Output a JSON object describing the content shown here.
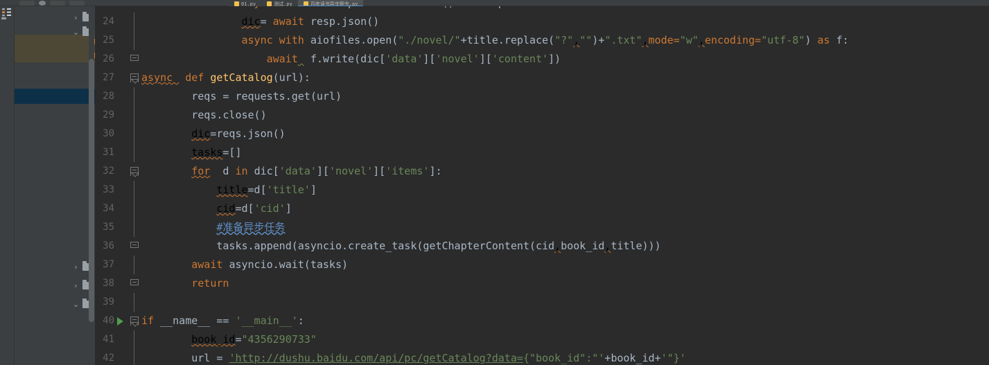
{
  "app": {
    "theme": "darcula",
    "accent_hex": "#4a88c7",
    "editor_bg_hex": "#2b2b2b",
    "panel_bg_hex": "#3c3f41",
    "selection_blue_hex": "#0d3049",
    "highlight_olive_hex": "#4d4836"
  },
  "toolbar": {
    "buttons": [
      {
        "name": "open-button",
        "label": ""
      },
      {
        "name": "save-button",
        "label": ""
      },
      {
        "name": "sync-button",
        "label": ""
      },
      {
        "name": "undo-button",
        "label": ""
      },
      {
        "name": "redo-button",
        "label": ""
      }
    ]
  },
  "tabs": [
    {
      "name": "tab-file-1",
      "label": "01.py",
      "active": false,
      "icon": "python-file-icon"
    },
    {
      "name": "tab-file-2",
      "label": "测试.py",
      "active": false,
      "icon": "python-file-icon"
    },
    {
      "name": "tab-file-3",
      "label": "百度读书异步爬虫.py",
      "active": true,
      "icon": "python-file-icon"
    }
  ],
  "left_strip": {
    "items": [
      {
        "name": "structure-tool-icon",
        "label": "Structure"
      },
      {
        "name": "project-folder-icon",
        "label": "Project"
      }
    ]
  },
  "project_tree": {
    "scrollbar": {
      "name": "project-scrollbar",
      "visible": true
    },
    "rows": [
      {
        "name": "tree-row-collapsed-1",
        "chevron": "chevron-right-icon",
        "icon": "folder-icon",
        "label": "",
        "state": "collapsed"
      },
      {
        "name": "tree-row-expanded-1",
        "chevron": "chevron-down-icon",
        "icon": "folder-icon",
        "label": "",
        "state": "expanded"
      },
      {
        "name": "tree-row-highlight-1",
        "chevron": "",
        "icon": "",
        "label": "",
        "state": "highlighted"
      },
      {
        "name": "tree-row-highlight-2",
        "chevron": "",
        "icon": "",
        "label": "",
        "state": "highlighted"
      },
      {
        "name": "tree-row-plain-1",
        "chevron": "",
        "icon": "",
        "label": "",
        "state": "normal"
      },
      {
        "name": "tree-row-selected",
        "chevron": "",
        "icon": "",
        "label": "",
        "state": "selected"
      },
      {
        "name": "tree-row-collapsed-2",
        "chevron": "chevron-right-icon",
        "icon": "folder-icon",
        "label": "",
        "state": "collapsed"
      },
      {
        "name": "tree-row-collapsed-3",
        "chevron": "chevron-right-icon",
        "icon": "folder-icon",
        "label": "",
        "state": "collapsed"
      },
      {
        "name": "tree-row-expanded-2",
        "chevron": "chevron-down-icon",
        "icon": "folder-icon",
        "label": "",
        "state": "expanded"
      }
    ]
  },
  "editor": {
    "language": "Python",
    "first_visible_line": 23,
    "last_visible_line": 42,
    "lines": [
      {
        "number": "24",
        "fold": "none",
        "indent_guides": 2,
        "tokens": [
          {
            "t": "                ",
            "c": "ws"
          },
          {
            "t": "dic",
            "c": "squig"
          },
          {
            "t": "= ",
            "c": "def"
          },
          {
            "t": "await ",
            "c": "kw"
          },
          {
            "t": "resp.json()",
            "c": "def"
          }
        ]
      },
      {
        "number": "25",
        "fold": "none",
        "indent_guides": 2,
        "tokens": [
          {
            "t": "                ",
            "c": "ws"
          },
          {
            "t": "async with ",
            "c": "kw"
          },
          {
            "t": "aiofiles.open(",
            "c": "def"
          },
          {
            "t": "\"./novel/\"",
            "c": "str"
          },
          {
            "t": "+title.replace(",
            "c": "def"
          },
          {
            "t": "\"?\"",
            "c": "str"
          },
          {
            "t": ",",
            "c": "squig"
          },
          {
            "t": "\"\"",
            "c": "str"
          },
          {
            "t": ")+",
            "c": "def"
          },
          {
            "t": "\".txt\"",
            "c": "str"
          },
          {
            "t": ",",
            "c": "squig"
          },
          {
            "t": "mode=",
            "c": "kw"
          },
          {
            "t": "\"w\"",
            "c": "str"
          },
          {
            "t": ",",
            "c": "squig"
          },
          {
            "t": "encoding=",
            "c": "kw"
          },
          {
            "t": "\"utf-8\"",
            "c": "str"
          },
          {
            "t": ") ",
            "c": "def"
          },
          {
            "t": "as ",
            "c": "kw"
          },
          {
            "t": "f:",
            "c": "def"
          }
        ]
      },
      {
        "number": "26",
        "fold": "end",
        "indent_guides": 3,
        "tokens": [
          {
            "t": "                    ",
            "c": "ws"
          },
          {
            "t": "await",
            "c": "kw"
          },
          {
            "t": " ",
            "c": "squig-b"
          },
          {
            "t": " f.write(dic[",
            "c": "def"
          },
          {
            "t": "'data'",
            "c": "str"
          },
          {
            "t": "][",
            "c": "def"
          },
          {
            "t": "'novel'",
            "c": "str"
          },
          {
            "t": "][",
            "c": "def"
          },
          {
            "t": "'content'",
            "c": "str"
          },
          {
            "t": "])",
            "c": "def"
          }
        ]
      },
      {
        "number": "27",
        "fold": "start",
        "indent_guides": 0,
        "tokens": [
          {
            "t": "async ",
            "c": "kw squig"
          },
          {
            "t": " def ",
            "c": "kw"
          },
          {
            "t": "getCatalog",
            "c": "fn"
          },
          {
            "t": "(url):",
            "c": "def"
          }
        ]
      },
      {
        "number": "28",
        "fold": "none",
        "indent_guides": 1,
        "tokens": [
          {
            "t": "        ",
            "c": "ws"
          },
          {
            "t": "reqs = requests.get(url)",
            "c": "def"
          }
        ]
      },
      {
        "number": "29",
        "fold": "none",
        "indent_guides": 1,
        "tokens": [
          {
            "t": "        ",
            "c": "ws"
          },
          {
            "t": "reqs.close()",
            "c": "def"
          }
        ]
      },
      {
        "number": "30",
        "fold": "none",
        "indent_guides": 1,
        "tokens": [
          {
            "t": "        ",
            "c": "ws"
          },
          {
            "t": "dic",
            "c": "squig"
          },
          {
            "t": "=reqs.json()",
            "c": "def"
          }
        ]
      },
      {
        "number": "31",
        "fold": "none",
        "indent_guides": 1,
        "tokens": [
          {
            "t": "        ",
            "c": "ws"
          },
          {
            "t": "tasks",
            "c": "squig"
          },
          {
            "t": "=[]",
            "c": "def"
          }
        ]
      },
      {
        "number": "32",
        "fold": "start",
        "indent_guides": 1,
        "tokens": [
          {
            "t": "        ",
            "c": "ws"
          },
          {
            "t": "for",
            "c": "kw squig"
          },
          {
            "t": "  d ",
            "c": "def"
          },
          {
            "t": "in ",
            "c": "kw"
          },
          {
            "t": "dic[",
            "c": "def"
          },
          {
            "t": "'data'",
            "c": "str"
          },
          {
            "t": "][",
            "c": "def"
          },
          {
            "t": "'novel'",
            "c": "str"
          },
          {
            "t": "][",
            "c": "def"
          },
          {
            "t": "'items'",
            "c": "str"
          },
          {
            "t": "]:",
            "c": "def"
          }
        ]
      },
      {
        "number": "33",
        "fold": "none",
        "indent_guides": 2,
        "tokens": [
          {
            "t": "            ",
            "c": "ws"
          },
          {
            "t": "title",
            "c": "squig"
          },
          {
            "t": "=d[",
            "c": "def"
          },
          {
            "t": "'title'",
            "c": "str"
          },
          {
            "t": "]",
            "c": "def"
          }
        ]
      },
      {
        "number": "34",
        "fold": "none",
        "indent_guides": 2,
        "tokens": [
          {
            "t": "            ",
            "c": "ws"
          },
          {
            "t": "cid",
            "c": "squig"
          },
          {
            "t": "=d[",
            "c": "def"
          },
          {
            "t": "'cid'",
            "c": "str"
          },
          {
            "t": "]",
            "c": "def"
          }
        ]
      },
      {
        "number": "35",
        "fold": "none",
        "indent_guides": 2,
        "tokens": [
          {
            "t": "            ",
            "c": "ws"
          },
          {
            "t": "#准备异步任务",
            "c": "cmt-cn"
          }
        ]
      },
      {
        "number": "36",
        "fold": "end",
        "indent_guides": 2,
        "tokens": [
          {
            "t": "            ",
            "c": "ws"
          },
          {
            "t": "tasks.append(asyncio.create_task(getChapterContent(cid",
            "c": "def"
          },
          {
            "t": ",",
            "c": "squig"
          },
          {
            "t": "book_id",
            "c": "def"
          },
          {
            "t": ",",
            "c": "squig"
          },
          {
            "t": "title)))",
            "c": "def"
          }
        ]
      },
      {
        "number": "37",
        "fold": "none",
        "indent_guides": 1,
        "tokens": [
          {
            "t": "        ",
            "c": "ws"
          },
          {
            "t": "await ",
            "c": "kw"
          },
          {
            "t": "asyncio.wait(tasks)",
            "c": "def"
          }
        ]
      },
      {
        "number": "38",
        "fold": "end",
        "indent_guides": 1,
        "tokens": [
          {
            "t": "        ",
            "c": "ws"
          },
          {
            "t": "return",
            "c": "kw"
          }
        ]
      },
      {
        "number": "39",
        "fold": "none",
        "indent_guides": 0,
        "tokens": []
      },
      {
        "number": "40",
        "fold": "start",
        "run_marker": true,
        "indent_guides": 0,
        "tokens": [
          {
            "t": "if ",
            "c": "kw"
          },
          {
            "t": "__name__ == ",
            "c": "def"
          },
          {
            "t": "'__main__'",
            "c": "str"
          },
          {
            "t": ":",
            "c": "def"
          }
        ]
      },
      {
        "number": "41",
        "fold": "none",
        "indent_guides": 1,
        "tokens": [
          {
            "t": "        ",
            "c": "ws"
          },
          {
            "t": "book_id",
            "c": "squig"
          },
          {
            "t": "=",
            "c": "def"
          },
          {
            "t": "\"4356290733\"",
            "c": "str"
          }
        ]
      },
      {
        "number": "42",
        "fold": "none",
        "indent_guides": 1,
        "tokens": [
          {
            "t": "        ",
            "c": "ws"
          },
          {
            "t": "url = ",
            "c": "def"
          },
          {
            "t": "'http://dushu.baidu.com/api/pc/getCatalog?data=",
            "c": "url"
          },
          {
            "t": "{\"book_id\":\"'",
            "c": "str"
          },
          {
            "t": "+book_id+",
            "c": "def"
          },
          {
            "t": "'\"}'",
            "c": "str"
          }
        ]
      }
    ]
  }
}
